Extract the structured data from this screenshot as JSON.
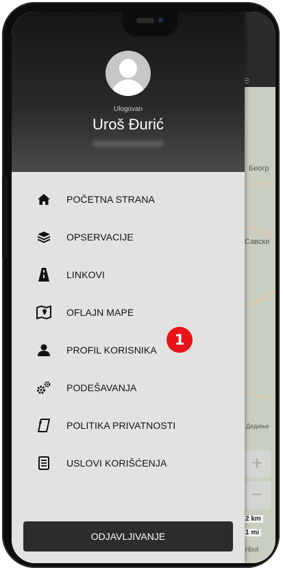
{
  "user": {
    "status_label": "Ulogovan",
    "name": "Uroš Đurić"
  },
  "menu": {
    "items": [
      {
        "label": "POČETNA STRANA",
        "icon": "home-icon"
      },
      {
        "label": "OPSERVACIJE",
        "icon": "layers-icon"
      },
      {
        "label": "LINKOVI",
        "icon": "road-icon"
      },
      {
        "label": "OFLAJN MAPE",
        "icon": "map-pin-icon"
      },
      {
        "label": "PROFIL KORISNIKA",
        "icon": "user-icon"
      },
      {
        "label": "PODEŠAVANJA",
        "icon": "gears-icon"
      },
      {
        "label": "POLITIKA PRIVATNOSTI",
        "icon": "document-icon"
      },
      {
        "label": "USLOVI KORIŠĆENJA",
        "icon": "list-icon"
      }
    ]
  },
  "logout_label": "ODJAVLJIVANJE",
  "annotation_badge": "1",
  "map": {
    "tab_fragment": "e",
    "labels": [
      "Беогр",
      "Савски",
      "Дедиње"
    ],
    "scale_km": "2 km",
    "scale_mi": "1 mi",
    "zoom_in": "+",
    "zoom_out": "−",
    "attribution_fragment": "tribut"
  },
  "colors": {
    "badge": "#e6151b",
    "drawer_bg": "#e2e2e2",
    "header_dark": "#151515",
    "logout_bg": "#2c2c2c"
  }
}
